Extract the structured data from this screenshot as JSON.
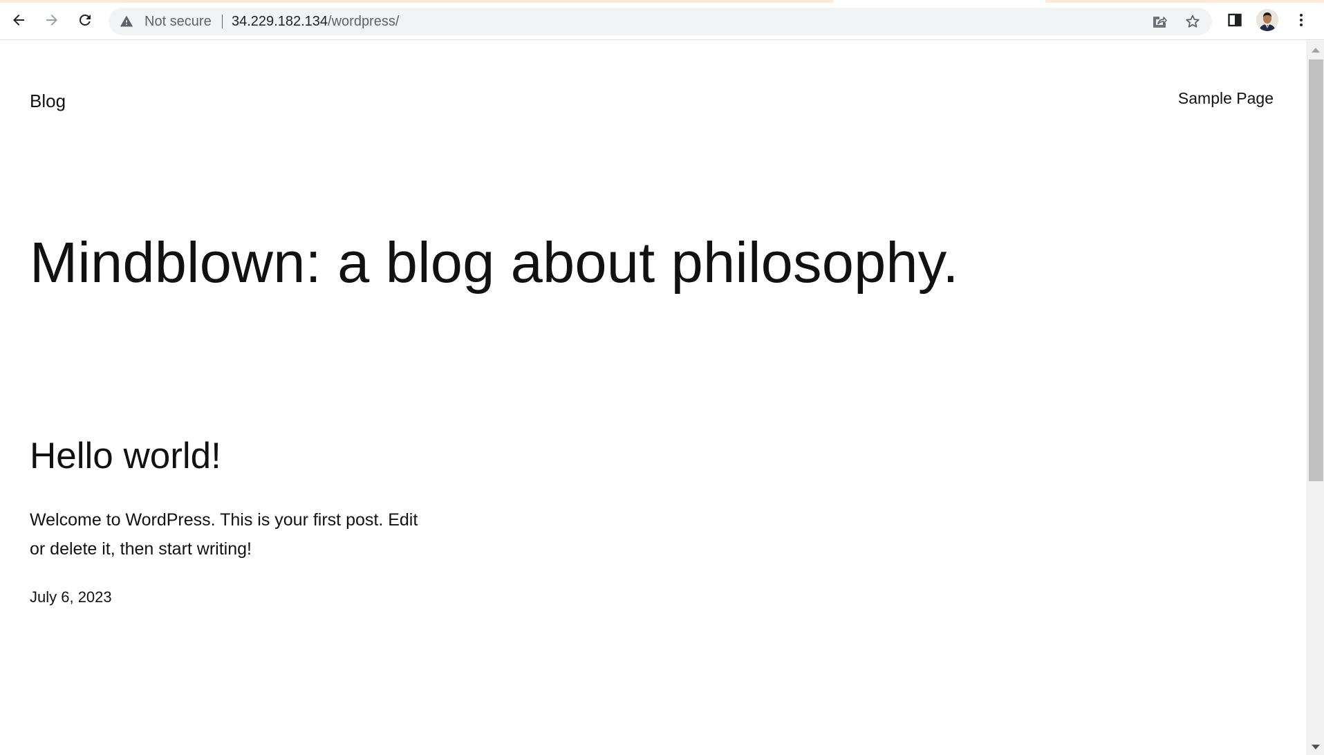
{
  "browser": {
    "security_label": "Not secure",
    "url_host": "34.229.182.134",
    "url_path": "/wordpress/",
    "icons": {
      "back": "arrow-left-icon",
      "forward": "arrow-right-icon",
      "reload": "reload-icon",
      "warning": "warning-triangle-icon",
      "share": "share-icon",
      "bookmark": "star-icon",
      "side_panel": "side-panel-icon",
      "profile": "avatar",
      "menu": "kebab-menu-icon"
    }
  },
  "site": {
    "title": "Blog",
    "nav": [
      {
        "label": "Sample Page"
      }
    ],
    "tagline": "Mindblown: a blog about philosophy."
  },
  "posts": [
    {
      "title": "Hello world!",
      "excerpt": "Welcome to WordPress. This is your first post. Edit or delete it, then start writing!",
      "date": "July 6, 2023"
    }
  ],
  "colors": {
    "text": "#111111",
    "chrome_omnibox": "#f1f3f4",
    "tab_accent": "#fde7d6",
    "scroll_thumb": "#c1c1c1"
  }
}
